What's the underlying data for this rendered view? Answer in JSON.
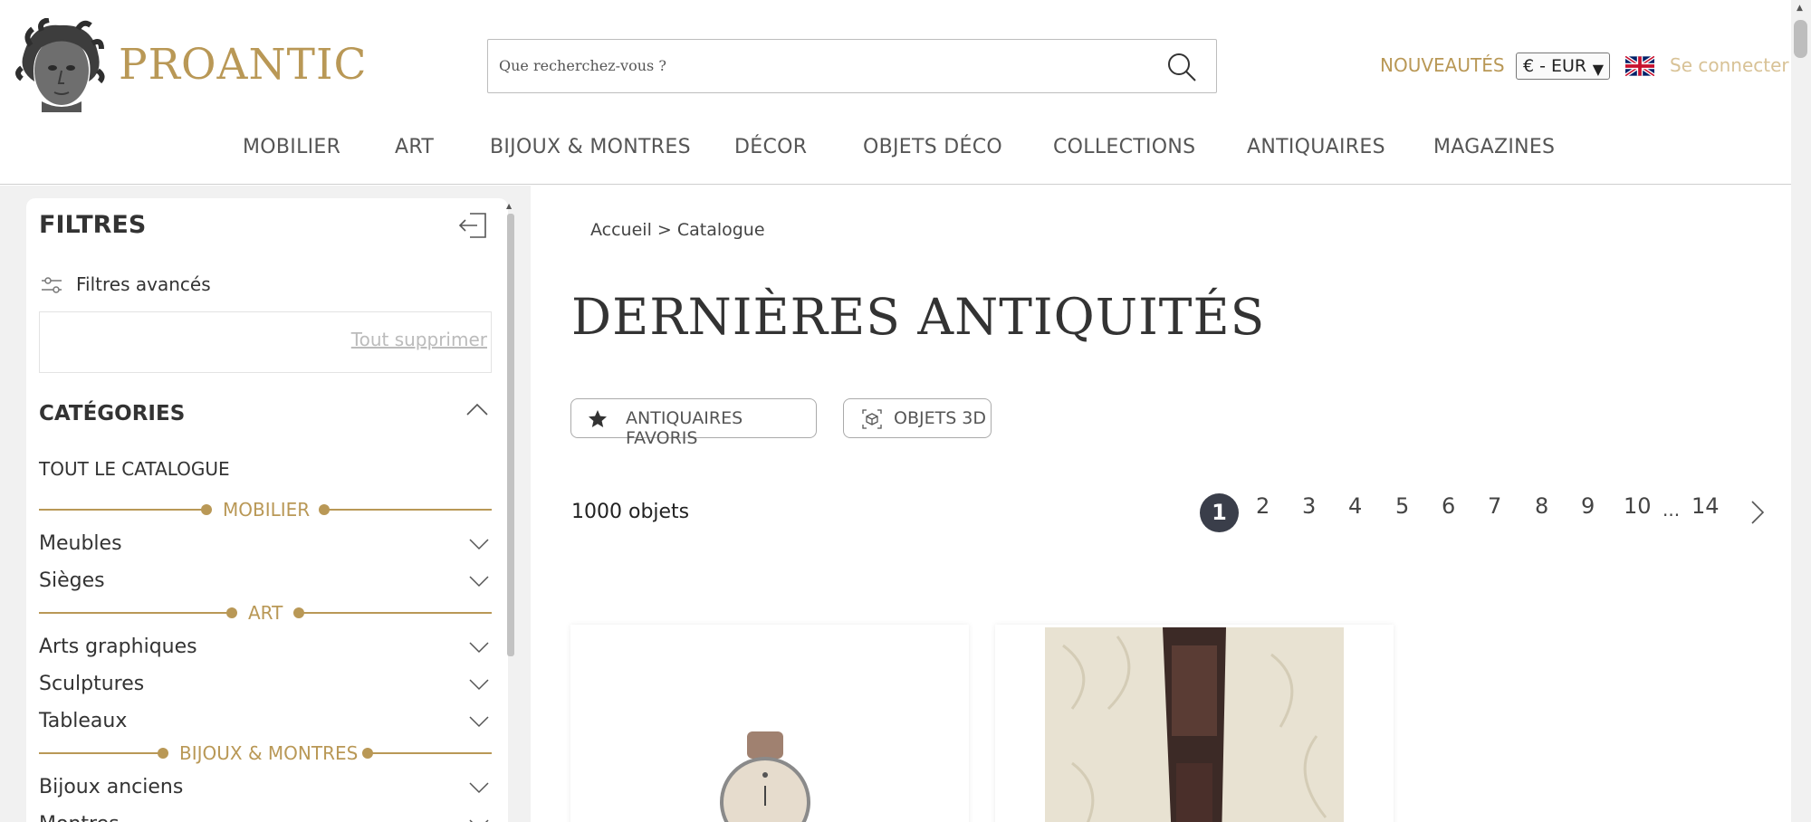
{
  "header": {
    "brand": "PROANTIC",
    "search_placeholder": "Que recherchez-vous ?",
    "new_label": "NOUVEAUTÉS",
    "currency": "€ - EUR",
    "login_label": "Se connecter"
  },
  "nav": {
    "items": [
      "MOBILIER",
      "ART",
      "BIJOUX & MONTRES",
      "DÉCOR",
      "OBJETS DÉCO",
      "COLLECTIONS",
      "ANTIQUAIRES",
      "MAGAZINES"
    ]
  },
  "sidebar": {
    "title": "FILTRES",
    "advanced_label": "Filtres avancés",
    "clear_all": "Tout supprimer",
    "categories_title": "CATÉGORIES",
    "all_catalog": "TOUT LE CATALOGUE",
    "groups": [
      {
        "label": "MOBILIER",
        "items": [
          "Meubles",
          "Sièges"
        ]
      },
      {
        "label": "ART",
        "items": [
          "Arts graphiques",
          "Sculptures",
          "Tableaux"
        ]
      },
      {
        "label": "BIJOUX & MONTRES",
        "items": [
          "Bijoux anciens",
          "Montres"
        ]
      }
    ]
  },
  "main": {
    "breadcrumb": "Accueil > Catalogue",
    "title": "DERNIÈRES ANTIQUITÉS",
    "pill_favorites": "ANTIQUAIRES FAVORIS",
    "pill_3d": "OBJETS 3D",
    "count": "1000 objets",
    "pagination": {
      "current": "1",
      "pages": [
        "2",
        "3",
        "4",
        "5",
        "6",
        "7",
        "8",
        "9",
        "10"
      ],
      "ellipsis": "...",
      "last": "14"
    }
  },
  "colors": {
    "accent": "#b99856",
    "text": "#333333",
    "active_page": "#3a3e4a"
  }
}
